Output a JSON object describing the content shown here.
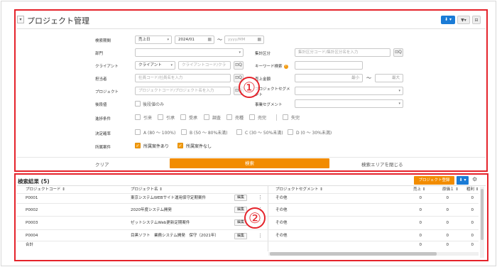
{
  "header": {
    "collapse_icon": "▾",
    "title": "プロジェクト管理",
    "download_icon": "⬇ ▾",
    "filter_icon": "▼▾",
    "folder_icon": "⊟"
  },
  "form": {
    "period": {
      "label": "検索期間",
      "type_value": "売上日",
      "from_value": "2024/01",
      "tilde": "〜",
      "to_placeholder": "yyyy/MM"
    },
    "department": {
      "label": "部門"
    },
    "aggregation": {
      "label": "集計区分",
      "placeholder": "集計区分コード/集計区分名を入力"
    },
    "client": {
      "label": "クライアント",
      "type_value": "クライアント",
      "placeholder": "クライアントコード/クラ"
    },
    "keyword": {
      "label": "キーワード検索",
      "help": "?"
    },
    "staff": {
      "label": "担当者",
      "placeholder": "社員コード/社員名を入力"
    },
    "sales_amount": {
      "label": "売上金額",
      "min_placeholder": "最小",
      "tilde": "〜",
      "max_placeholder": "最大"
    },
    "project": {
      "label": "プロジェクト",
      "placeholder": "プロジェクトコード/プロジェクト名を入力"
    },
    "project_segment": {
      "label": "プロジェクトセグメント"
    },
    "backdate": {
      "label": "後段値",
      "option": "後段値のみ"
    },
    "business_segment": {
      "label": "事業セグメント"
    },
    "progress": {
      "label": "進捗条件",
      "options": [
        "引来",
        "引承",
        "受承",
        "調査",
        "売種",
        "売完"
      ],
      "extra": "失完"
    },
    "probability": {
      "label": "決定確率",
      "options": [
        "A (80 〜 100%)",
        "B (50 〜 80%未満)",
        "C (30 〜 50%未満)",
        "D (0 〜 30%未満)"
      ]
    },
    "ownership": {
      "label": "所属案件",
      "options": [
        "所属案件あり",
        "所属案件なし"
      ]
    },
    "search_icon": "⊡Q"
  },
  "actions": {
    "clear": "クリア",
    "search": "検索",
    "close_area": "検索エリアを閉じる"
  },
  "results": {
    "title": "検索結果 (5)",
    "register_button": "プロジェクト登録",
    "download_icon": "⬇ ▾",
    "settings_icon": "⚙",
    "columns": {
      "code": "プロジェクトコード ⇕",
      "name": "プロジェクト名 ⇕",
      "segment": "プロジェクトセグメント ⇕",
      "sales": "売上 ⇕",
      "cost": "原価１ ⇕",
      "profit": "粗利 ⇕"
    },
    "edit_label": "編集",
    "kebab": "⋮",
    "rows": [
      {
        "code": "P0001",
        "name": "東京システムWEBサイト運用保守定期案件",
        "segment": "その他",
        "sales": "0",
        "cost": "0",
        "profit": "0"
      },
      {
        "code": "P0002",
        "name": "2020年度システム開発",
        "segment": "その他",
        "sales": "0",
        "cost": "0",
        "profit": "0"
      },
      {
        "code": "P0003",
        "name": "ゼットシステムWeb更新定期案件",
        "segment": "その他",
        "sales": "0",
        "cost": "0",
        "profit": "0"
      },
      {
        "code": "P0004",
        "name": "目黒ソフト　業務システム開発　保守（2021年）",
        "segment": "その他",
        "sales": "0",
        "cost": "0",
        "profit": "0"
      }
    ],
    "total": {
      "label": "合計",
      "sales": "0",
      "cost": "0",
      "profit": "0"
    }
  },
  "annotations": {
    "one": "①",
    "two": "②"
  },
  "colors": {
    "accent": "#f28c00",
    "primary": "#1a7bd6",
    "highlight": "#e5232b"
  }
}
